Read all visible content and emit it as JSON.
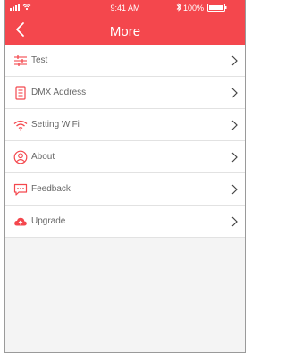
{
  "status_bar": {
    "time": "9:41 AM",
    "battery_percent": "100%"
  },
  "header": {
    "title": "More",
    "back_icon": "chevron-left-icon"
  },
  "menu": {
    "items": [
      {
        "label": "Test",
        "icon": "sliders-icon"
      },
      {
        "label": "DMX Address",
        "icon": "document-icon"
      },
      {
        "label": "Setting WiFi",
        "icon": "wifi-icon"
      },
      {
        "label": "About",
        "icon": "user-circle-icon"
      },
      {
        "label": "Feedback",
        "icon": "chat-bubble-icon"
      },
      {
        "label": "Upgrade",
        "icon": "cloud-upload-icon"
      }
    ]
  },
  "colors": {
    "accent": "#f4474d",
    "background": "#f4f4f4",
    "menu_text": "#666666"
  }
}
